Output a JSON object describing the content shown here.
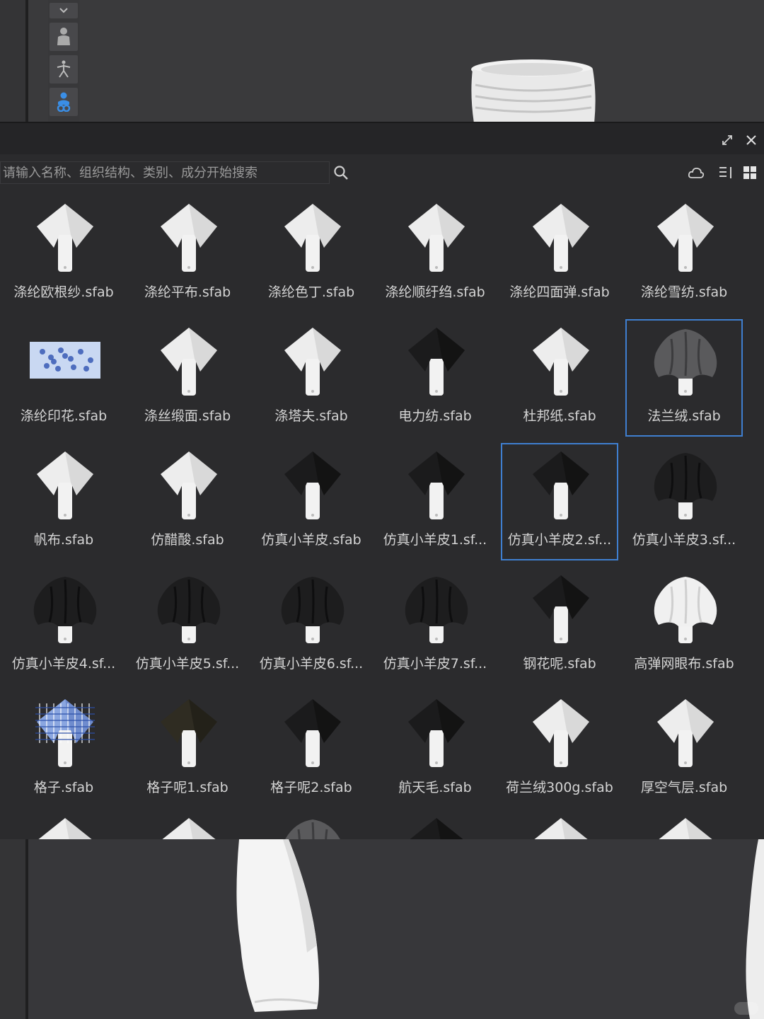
{
  "panel": {
    "search_placeholder": "请输入名称、组织结构、类别、成分开始搜索"
  },
  "materials": [
    {
      "label": "涤纶欧根纱.sfab",
      "tone": "white",
      "selected": false
    },
    {
      "label": "涤纶平布.sfab",
      "tone": "white",
      "selected": false
    },
    {
      "label": "涤纶色丁.sfab",
      "tone": "white",
      "selected": false
    },
    {
      "label": "涤纶顺纡绉.sfab",
      "tone": "white",
      "selected": false
    },
    {
      "label": "涤纶四面弹.sfab",
      "tone": "white",
      "selected": false
    },
    {
      "label": "涤纶雪纺.sfab",
      "tone": "white",
      "selected": false
    },
    {
      "label": "涤纶印花.sfab",
      "tone": "print",
      "selected": false
    },
    {
      "label": "涤丝缎面.sfab",
      "tone": "white",
      "selected": false
    },
    {
      "label": "涤塔夫.sfab",
      "tone": "white",
      "selected": false
    },
    {
      "label": "电力纺.sfab",
      "tone": "black",
      "selected": false
    },
    {
      "label": "杜邦纸.sfab",
      "tone": "white",
      "selected": false
    },
    {
      "label": "法兰绒.sfab",
      "tone": "grey",
      "selected": true
    },
    {
      "label": "帆布.sfab",
      "tone": "white",
      "selected": false
    },
    {
      "label": "仿醋酸.sfab",
      "tone": "white",
      "selected": false
    },
    {
      "label": "仿真小羊皮.sfab",
      "tone": "black",
      "selected": false
    },
    {
      "label": "仿真小羊皮1.sf...",
      "tone": "black",
      "selected": false
    },
    {
      "label": "仿真小羊皮2.sf...",
      "tone": "black",
      "selected": true
    },
    {
      "label": "仿真小羊皮3.sf...",
      "tone": "blackdrape",
      "selected": false
    },
    {
      "label": "仿真小羊皮4.sf...",
      "tone": "blackdrape",
      "selected": false
    },
    {
      "label": "仿真小羊皮5.sf...",
      "tone": "blackdrape",
      "selected": false
    },
    {
      "label": "仿真小羊皮6.sf...",
      "tone": "blackdrape",
      "selected": false
    },
    {
      "label": "仿真小羊皮7.sf...",
      "tone": "blackdrape",
      "selected": false
    },
    {
      "label": "钢花呢.sfab",
      "tone": "black",
      "selected": false
    },
    {
      "label": "高弹网眼布.sfab",
      "tone": "whitedrape",
      "selected": false
    },
    {
      "label": "格子.sfab",
      "tone": "check",
      "selected": false
    },
    {
      "label": "格子呢1.sfab",
      "tone": "olive",
      "selected": false
    },
    {
      "label": "格子呢2.sfab",
      "tone": "black",
      "selected": false
    },
    {
      "label": "航天毛.sfab",
      "tone": "black",
      "selected": false
    },
    {
      "label": "荷兰绒300g.sfab",
      "tone": "white",
      "selected": false
    },
    {
      "label": "厚空气层.sfab",
      "tone": "white",
      "selected": false
    }
  ],
  "colors": {
    "selection": "#3f7fd0",
    "tool_active": "#3a8ee6"
  }
}
